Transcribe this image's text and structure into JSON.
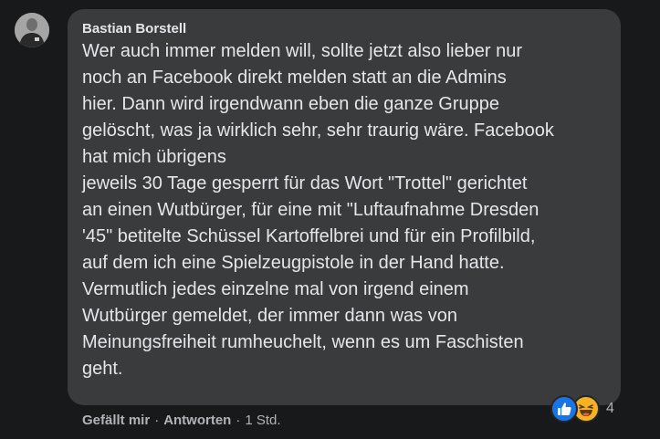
{
  "comment": {
    "author": "Bastian Borstell",
    "lines": [
      "Wer auch immer melden will, sollte jetzt also lieber nur",
      "noch an Facebook direkt melden statt an die Admins",
      "hier. Dann wird irgendwann eben die ganze Gruppe",
      "gelöscht, was ja wirklich sehr, sehr traurig wäre. Facebook",
      "hat mich übrigens",
      "jeweils 30 Tage gesperrt für das Wort \"Trottel\" gerichtet",
      "an einen Wutbürger, für eine mit \"Luftaufnahme Dresden",
      "'45\" betitelte Schüssel Kartoffelbrei und für ein Profilbild,",
      "auf dem ich eine Spielzeugpistole in der Hand hatte.",
      "Vermutlich jedes einzelne mal von irgend einem",
      "Wutbürger gemeldet, der immer dann was von",
      "Meinungsfreiheit rumheuchelt, wenn es um Faschisten",
      "geht."
    ],
    "reactions": {
      "icons": [
        "like-icon",
        "haha-icon"
      ],
      "count": "4"
    },
    "actions": {
      "like_label": "Gefällt mir",
      "separator": "·",
      "reply_label": "Antworten",
      "time": "1 Std."
    }
  },
  "colors": {
    "background": "#18191a",
    "bubble": "#3a3b3c",
    "text_primary": "#e4e6eb",
    "text_secondary": "#b0b3b8",
    "like_blue": "#1b74e4",
    "haha_yellow": "#f7b125"
  }
}
